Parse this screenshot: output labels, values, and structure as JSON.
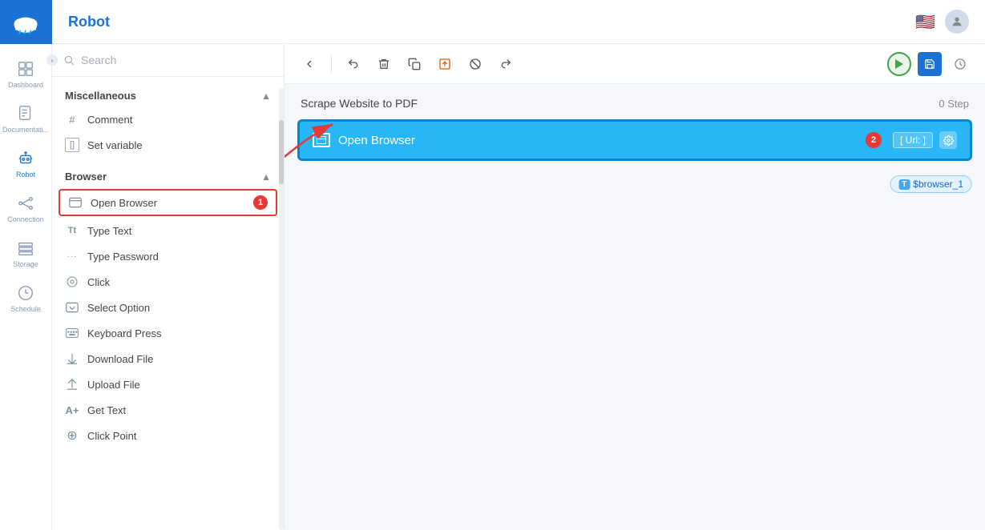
{
  "app": {
    "title": "Robot",
    "logo_alt": "cloud-logo"
  },
  "nav": {
    "items": [
      {
        "id": "dashboard",
        "label": "Dashboard",
        "icon": "grid"
      },
      {
        "id": "documentation",
        "label": "Documentati...",
        "icon": "doc"
      },
      {
        "id": "robot",
        "label": "Robot",
        "icon": "robot",
        "active": true
      },
      {
        "id": "connection",
        "label": "Connection",
        "icon": "connection"
      },
      {
        "id": "storage",
        "label": "Storage",
        "icon": "storage"
      },
      {
        "id": "schedule",
        "label": "Schedule",
        "icon": "schedule"
      }
    ]
  },
  "search": {
    "placeholder": "Search"
  },
  "sections": {
    "miscellaneous": {
      "label": "Miscellaneous",
      "items": [
        {
          "id": "comment",
          "label": "Comment",
          "icon": "#"
        },
        {
          "id": "set-variable",
          "label": "Set variable",
          "icon": "[]"
        }
      ]
    },
    "browser": {
      "label": "Browser",
      "items": [
        {
          "id": "open-browser",
          "label": "Open Browser",
          "icon": "□"
        },
        {
          "id": "type-text",
          "label": "Type Text",
          "icon": "Tt"
        },
        {
          "id": "type-password",
          "label": "Type Password",
          "icon": "···"
        },
        {
          "id": "click",
          "label": "Click",
          "icon": "⊙"
        },
        {
          "id": "select-option",
          "label": "Select Option",
          "icon": "⌄"
        },
        {
          "id": "keyboard-press",
          "label": "Keyboard Press",
          "icon": "⌨"
        },
        {
          "id": "download-file",
          "label": "Download File",
          "icon": "⬇"
        },
        {
          "id": "upload-file",
          "label": "Upload File",
          "icon": "⬆"
        },
        {
          "id": "get-text",
          "label": "Get Text",
          "icon": "A+"
        },
        {
          "id": "click-point",
          "label": "Click Point",
          "icon": "⊕"
        }
      ]
    }
  },
  "workspace": {
    "flow_title": "Scrape Website to PDF",
    "step_count": "0 Step",
    "open_browser_block": {
      "label": "Open Browser",
      "num": "2",
      "url_badge": "[ Url: ]",
      "variable": "$browser_1",
      "variable_prefix": "T"
    }
  },
  "toolbar": {
    "back_tooltip": "Back",
    "delete_tooltip": "Delete",
    "copy_tooltip": "Copy",
    "move_tooltip": "Move",
    "stop_tooltip": "Stop",
    "forward_tooltip": "Forward"
  },
  "annotations": {
    "num1": "1",
    "num2": "2"
  }
}
